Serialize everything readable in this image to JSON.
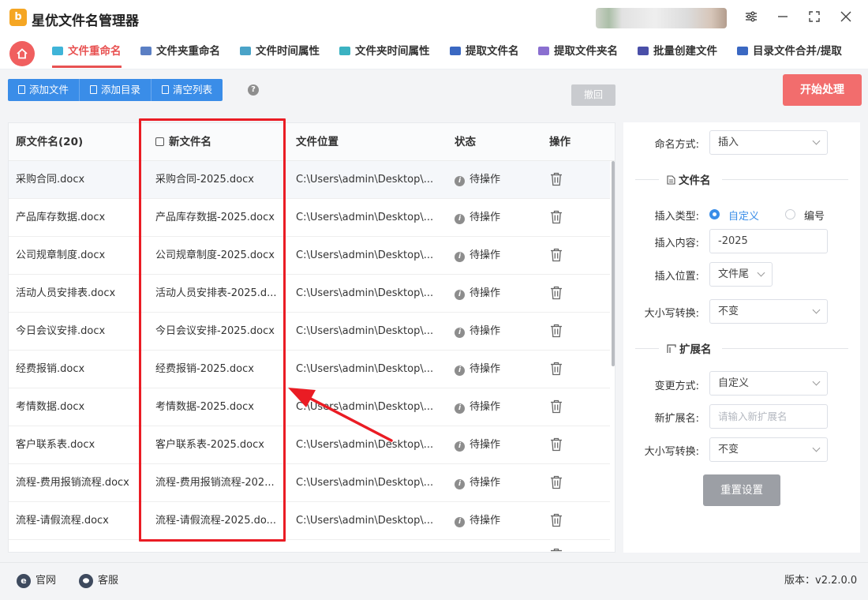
{
  "app": {
    "title": "星优文件名管理器",
    "logo_text": "b"
  },
  "tabs": [
    {
      "label": "文件重命名",
      "color": "#3fb4d8"
    },
    {
      "label": "文件夹重命名",
      "color": "#5b7fc4"
    },
    {
      "label": "文件时间属性",
      "color": "#4aa3c8"
    },
    {
      "label": "文件夹时间属性",
      "color": "#3bb2c2"
    },
    {
      "label": "提取文件名",
      "color": "#3a68c2"
    },
    {
      "label": "提取文件夹名",
      "color": "#8a6fd0"
    },
    {
      "label": "批量创建文件",
      "color": "#4a4fa8"
    },
    {
      "label": "目录文件合并/提取",
      "color": "#3a68c2"
    }
  ],
  "toolbar": {
    "add_file": "添加文件",
    "add_dir": "添加目录",
    "clear_list": "清空列表",
    "help": "?",
    "undo": "撤回",
    "start": "开始处理"
  },
  "table": {
    "headers": {
      "original": "原文件名(20)",
      "new_name": "新文件名",
      "location": "文件位置",
      "status": "状态",
      "action": "操作"
    },
    "rows": [
      {
        "original": "采购合同.docx",
        "new_name": "采购合同-2025.docx",
        "location": "C:\\Users\\admin\\Desktop\\...",
        "status": "待操作"
      },
      {
        "original": "产品库存数据.docx",
        "new_name": "产品库存数据-2025.docx",
        "location": "C:\\Users\\admin\\Desktop\\...",
        "status": "待操作"
      },
      {
        "original": "公司规章制度.docx",
        "new_name": "公司规章制度-2025.docx",
        "location": "C:\\Users\\admin\\Desktop\\...",
        "status": "待操作"
      },
      {
        "original": "活动人员安排表.docx",
        "new_name": "活动人员安排表-2025.d...",
        "location": "C:\\Users\\admin\\Desktop\\...",
        "status": "待操作"
      },
      {
        "original": "今日会议安排.docx",
        "new_name": "今日会议安排-2025.docx",
        "location": "C:\\Users\\admin\\Desktop\\...",
        "status": "待操作"
      },
      {
        "original": "经费报销.docx",
        "new_name": "经费报销-2025.docx",
        "location": "C:\\Users\\admin\\Desktop\\...",
        "status": "待操作"
      },
      {
        "original": "考情数据.docx",
        "new_name": "考情数据-2025.docx",
        "location": "C:\\Users\\admin\\Desktop\\...",
        "status": "待操作"
      },
      {
        "original": "客户联系表.docx",
        "new_name": "客户联系表-2025.docx",
        "location": "C:\\Users\\admin\\Desktop\\...",
        "status": "待操作"
      },
      {
        "original": "流程-费用报销流程.docx",
        "new_name": "流程-费用报销流程-202...",
        "location": "C:\\Users\\admin\\Desktop\\...",
        "status": "待操作"
      },
      {
        "original": "流程-请假流程.docx",
        "new_name": "流程-请假流程-2025.do...",
        "location": "C:\\Users\\admin\\Desktop\\...",
        "status": "待操作"
      }
    ]
  },
  "settings": {
    "naming_method_label": "命名方式:",
    "naming_method_value": "插入",
    "section_filename": "文件名",
    "insert_type_label": "插入类型:",
    "insert_type_option1": "自定义",
    "insert_type_option2": "编号",
    "insert_content_label": "插入内容:",
    "insert_content_value": "-2025",
    "insert_position_label": "插入位置:",
    "insert_position_value": "文件尾",
    "case_label_1": "大小写转换:",
    "case_value_1": "不变",
    "section_ext": "扩展名",
    "change_method_label": "变更方式:",
    "change_method_value": "自定义",
    "new_ext_label": "新扩展名:",
    "new_ext_placeholder": "请输入新扩展名",
    "case_label_2": "大小写转换:",
    "case_value_2": "不变",
    "reset": "重置设置"
  },
  "footer": {
    "website": "官网",
    "support": "客服",
    "version": "版本：v2.2.0.0"
  },
  "colors": {
    "accent_red": "#e85252",
    "primary_blue": "#3a8de8",
    "highlight_red": "#ea1c24"
  }
}
